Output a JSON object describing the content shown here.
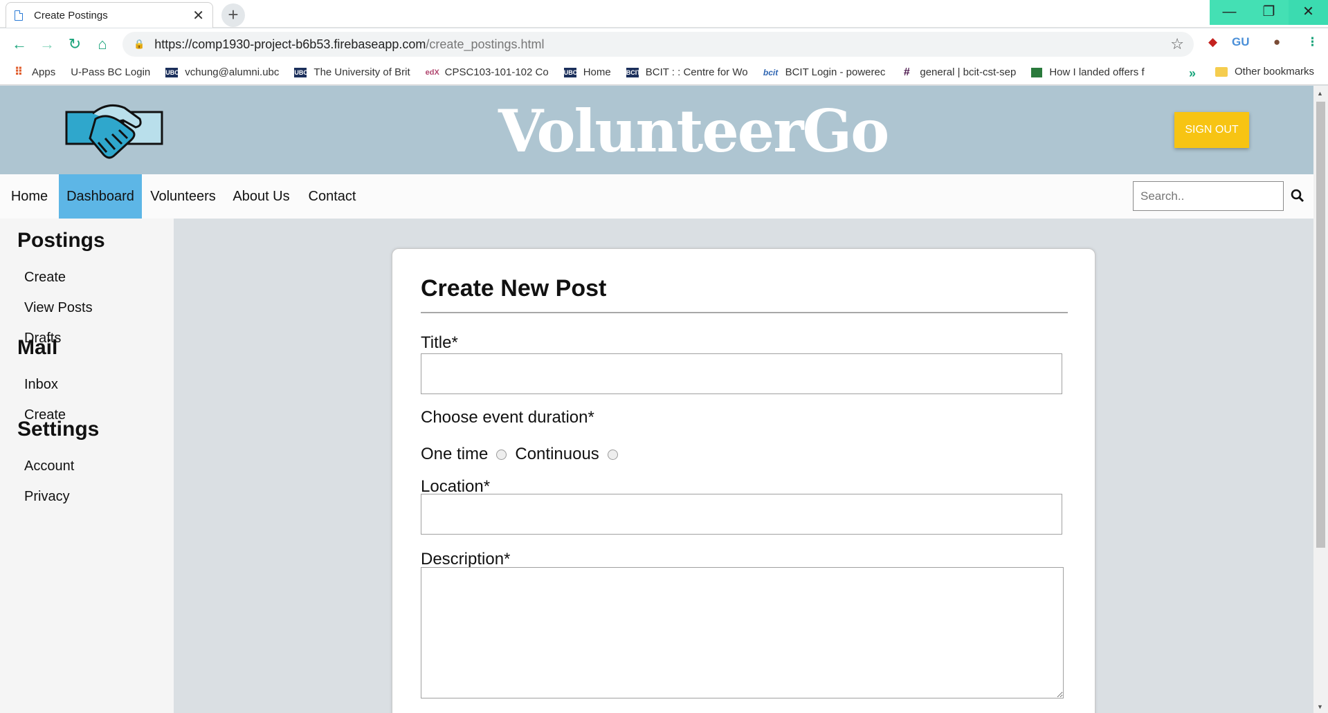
{
  "browser": {
    "tab_title": "Create Postings",
    "tab_close": "✕",
    "new_tab": "+",
    "window_controls": {
      "minimize": "—",
      "restore": "❐",
      "close": "✕"
    },
    "url_host": "https://comp1930-project-b6b53.firebaseapp.com",
    "url_path": "/create_postings.html",
    "bookmarks": [
      {
        "icon": "apps-grid-icon",
        "label": "Apps"
      },
      {
        "icon": "page-icon",
        "label": "U-Pass BC Login"
      },
      {
        "icon": "ubc-icon",
        "label": "vchung@alumni.ubc"
      },
      {
        "icon": "ubc-icon",
        "label": "The University of Brit"
      },
      {
        "icon": "edx-icon",
        "label": "CPSC103-101-102 Co"
      },
      {
        "icon": "ubc-icon",
        "label": "Home"
      },
      {
        "icon": "bcit-icon",
        "label": "BCIT : : Centre for Wo"
      },
      {
        "icon": "bcit-logo-icon",
        "label": "BCIT Login - powerec"
      },
      {
        "icon": "slack-icon",
        "label": "general | bcit-cst-sep"
      },
      {
        "icon": "green-icon",
        "label": "How I landed offers f"
      }
    ],
    "other_bookmarks": "Other bookmarks",
    "more": "»"
  },
  "header": {
    "brand": "VolunteerGo",
    "signout_label": "SIGN OUT"
  },
  "nav": {
    "items": [
      {
        "label": "Home"
      },
      {
        "label": "Dashboard",
        "active": true
      },
      {
        "label": "Volunteers"
      },
      {
        "label": "About Us"
      },
      {
        "label": "Contact"
      }
    ],
    "search_placeholder": "Search.."
  },
  "sidebar": {
    "sections": [
      {
        "heading": "Postings",
        "links": [
          "Create",
          "View Posts",
          "Drafts"
        ]
      },
      {
        "heading": "Mail",
        "links": [
          "Inbox",
          "Create"
        ]
      },
      {
        "heading": "Settings",
        "links": [
          "Account",
          "Privacy"
        ]
      }
    ]
  },
  "form": {
    "title": "Create New Post",
    "title_label": "Title*",
    "duration_label": "Choose event duration*",
    "option_one_time": "One time",
    "option_continuous": "Continuous",
    "location_label": "Location*",
    "description_label": "Description*"
  },
  "colors": {
    "header_bg": "#aec5d1",
    "nav_active": "#5db6e6",
    "signout_bg": "#f7c413",
    "page_bg": "#dadfe3",
    "chrome_accent": "#44e0b4"
  }
}
